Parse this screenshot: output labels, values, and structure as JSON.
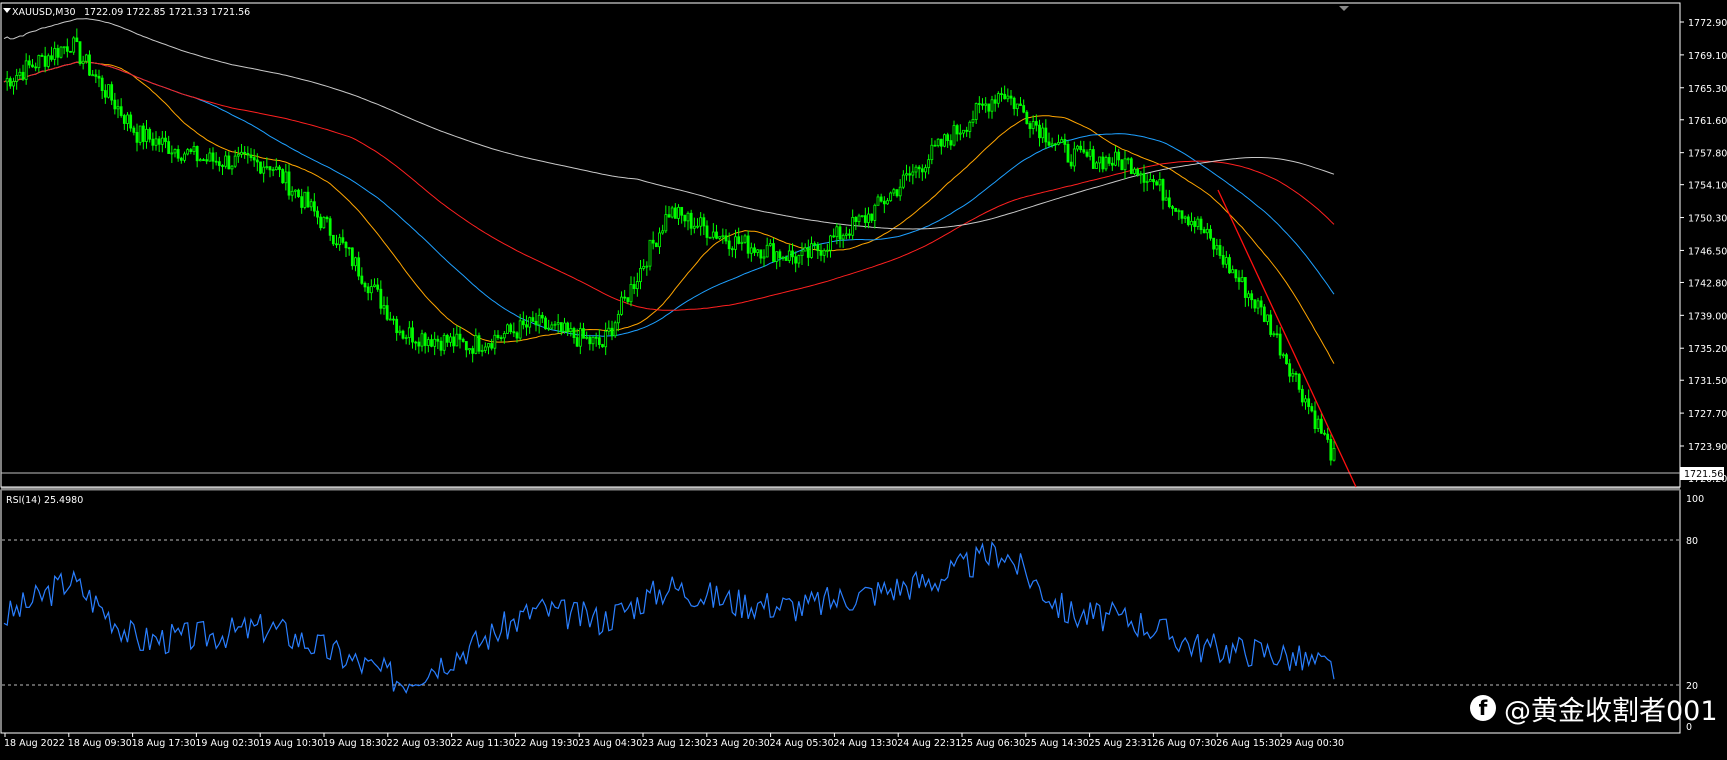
{
  "header": {
    "symbol": "XAUUSD,M30",
    "ohlc": "1722.09 1722.85 1721.33 1721.56"
  },
  "price_axis": {
    "ticks": [
      "1772.90",
      "1769.10",
      "1765.30",
      "1761.60",
      "1757.80",
      "1754.10",
      "1750.30",
      "1746.50",
      "1742.80",
      "1739.00",
      "1735.20",
      "1731.50",
      "1727.70",
      "1723.90",
      "1720.20"
    ],
    "current_price": "1721.56"
  },
  "rsi": {
    "label": "RSI(14) 25.4980",
    "levels": [
      "100",
      "80",
      "20",
      "0"
    ]
  },
  "time_axis": {
    "labels": [
      "18 Aug 2022",
      "18 Aug 09:30",
      "18 Aug 17:30",
      "19 Aug 02:30",
      "19 Aug 10:30",
      "19 Aug 18:30",
      "22 Aug 03:30",
      "22 Aug 11:30",
      "22 Aug 19:30",
      "23 Aug 04:30",
      "23 Aug 12:30",
      "23 Aug 20:30",
      "24 Aug 05:30",
      "24 Aug 13:30",
      "24 Aug 22:31",
      "25 Aug 06:30",
      "25 Aug 14:30",
      "25 Aug 23:31",
      "26 Aug 07:30",
      "26 Aug 15:30",
      "29 Aug 00:30"
    ]
  },
  "watermark": {
    "icon": "f",
    "text": "@黄金收割者001"
  },
  "colors": {
    "background": "#000000",
    "candle": "#00ff00",
    "rsi_line": "#1e90ff",
    "ma_white": "#c8c8c8",
    "ma_red": "#ff2020",
    "ma_blue": "#1ea0ff",
    "ma_orange": "#ffa500",
    "trendline": "#ff0000"
  },
  "chart_data": {
    "type": "line",
    "title": "XAUUSD,M30",
    "ylim": [
      1720.2,
      1772.9
    ],
    "rsi_ylim": [
      0,
      100
    ],
    "series": [
      {
        "name": "XAUUSD,M30",
        "x": [
          "18 Aug 2022",
          "18 Aug 09:30",
          "18 Aug 17:30",
          "19 Aug 02:30",
          "19 Aug 10:30",
          "19 Aug 18:30",
          "22 Aug 03:30",
          "22 Aug 11:30",
          "22 Aug 19:30",
          "23 Aug 04:30",
          "23 Aug 12:30",
          "23 Aug 20:30",
          "24 Aug 05:30",
          "24 Aug 13:30",
          "24 Aug 22:31",
          "25 Aug 06:30",
          "25 Aug 14:30",
          "25 Aug 23:31",
          "26 Aug 07:30",
          "26 Aug 15:30",
          "29 Aug 00:30"
        ],
        "y": [
          1766.0,
          1770.5,
          1760.0,
          1757.0,
          1756.5,
          1748.0,
          1737.0,
          1735.5,
          1738.0,
          1735.5,
          1751.0,
          1747.5,
          1745.5,
          1750.5,
          1758.0,
          1765.0,
          1757.5,
          1756.5,
          1749.0,
          1738.5,
          1722.5
        ]
      },
      {
        "name": "RSI(14)",
        "x": [
          "18 Aug 2022",
          "18 Aug 09:30",
          "18 Aug 17:30",
          "19 Aug 02:30",
          "19 Aug 10:30",
          "19 Aug 18:30",
          "22 Aug 03:30",
          "22 Aug 11:30",
          "22 Aug 19:30",
          "23 Aug 04:30",
          "23 Aug 12:30",
          "23 Aug 20:30",
          "24 Aug 05:30",
          "24 Aug 13:30",
          "24 Aug 22:31",
          "25 Aug 06:30",
          "25 Aug 14:30",
          "25 Aug 23:31",
          "26 Aug 07:30",
          "26 Aug 15:30",
          "29 Aug 00:30"
        ],
        "y": [
          48,
          65,
          38,
          40,
          44,
          32,
          20,
          35,
          52,
          47,
          62,
          55,
          53,
          59,
          65,
          78,
          50,
          47,
          35,
          33,
          25.5
        ]
      }
    ]
  }
}
